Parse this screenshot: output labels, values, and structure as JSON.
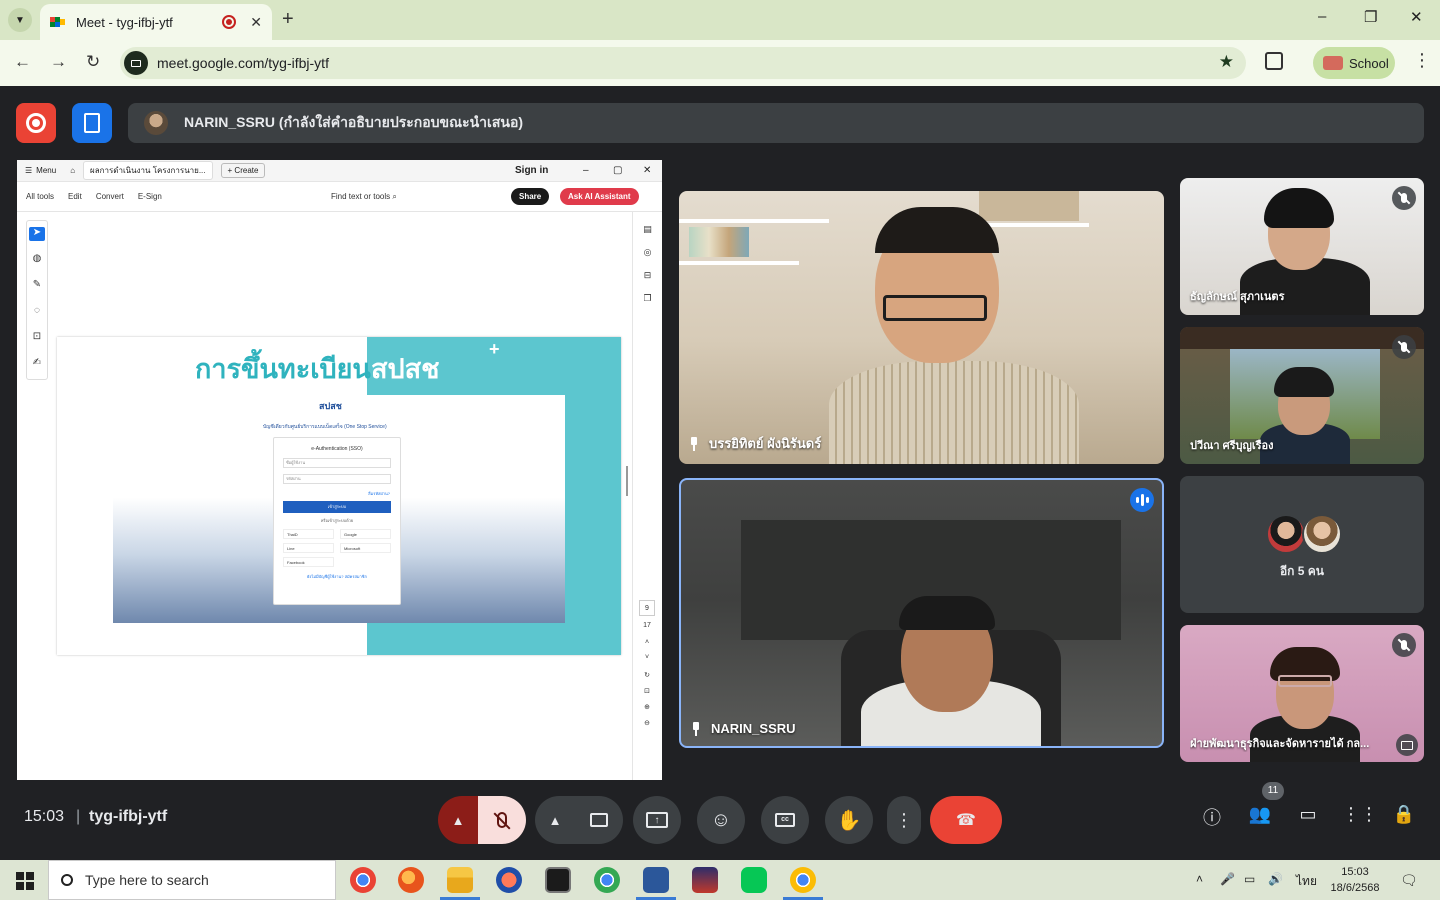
{
  "browser": {
    "tab_title": "Meet - tyg-ifbj-ytf",
    "new_tab": "+",
    "url": "meet.google.com/tyg-ifbj-ytf",
    "profile_name": "School",
    "window_controls": [
      "–",
      "❐",
      "✕"
    ]
  },
  "meet": {
    "presenter_banner": "NARIN_SSRU (กำลังใส่คำอธิบายประกอบขณะนำเสนอ)",
    "time": "15:03",
    "separator": "|",
    "meeting_code": "tyg-ifbj-ytf",
    "participants_count": "11",
    "tiles": [
      {
        "name": "บรรยิทิตย์ ผังนิรันดร์"
      },
      {
        "name": "NARIN_SSRU"
      },
      {
        "name": "ธัญลักษณ์ สุภาเนตร"
      },
      {
        "name": "ปวีณา ศรีบุญเรือง"
      },
      {
        "more_label": "อีก 5 คน"
      },
      {
        "name": "ฝ่ายพัฒนาธุรกิจและจัดหารายได้ กล..."
      }
    ]
  },
  "shared_screen": {
    "menu_label": "Menu",
    "doc_tab": "ผลการดำเนินงาน โครงการนาย...",
    "create_label": "Create",
    "sign_in": "Sign in",
    "menu_items": [
      "All tools",
      "Edit",
      "Convert",
      "E-Sign"
    ],
    "find_label": "Find text or tools",
    "share_label": "Share",
    "ai_label": "Ask AI Assistant",
    "slide_title_a": "การขึ้นทะเบียน",
    "slide_title_b": "สปสช",
    "shot_logo": "สปสช",
    "shot_subtitle": "บัญชีเดียวกับศูนย์บริการแบบเบ็ดเสร็จ (One Stop Service)",
    "card_title": "e-Authentication (SSO)",
    "card_user": "ชื่อผู้ใช้งาน",
    "card_pass": "รหัสผ่าน",
    "card_forgot": "ลืมรหัสผ่าน?",
    "card_login": "เข้าสู่ระบบ",
    "card_or": "หรือเข้าสู่ระบบด้วย",
    "card_options": [
      "ThaiD",
      "Google",
      "Line",
      "Microsoft",
      "Facebook"
    ],
    "card_footer": "ยังไม่มีบัญชีผู้ใช้งาน? สมัครสมาชิก",
    "page_current": "9",
    "page_total": "17"
  },
  "taskbar": {
    "search_placeholder": "Type here to search",
    "lang": "ไทย",
    "time": "15:03",
    "date": "18/6/2568"
  }
}
